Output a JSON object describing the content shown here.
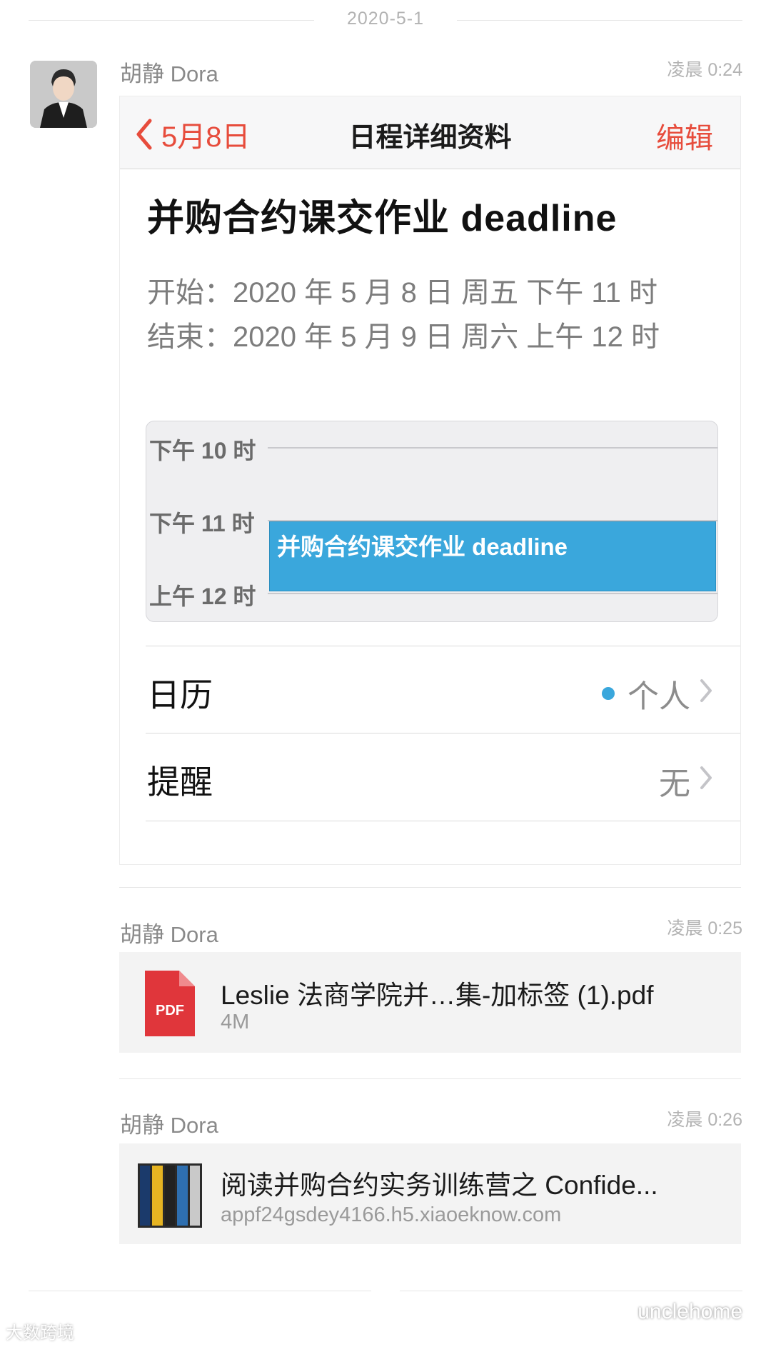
{
  "date_header": "2020-5-1",
  "messages": [
    {
      "sender": "胡静 Dora",
      "time": "凌晨 0:24"
    },
    {
      "sender": "胡静 Dora",
      "time": "凌晨 0:25"
    },
    {
      "sender": "胡静 Dora",
      "time": "凌晨 0:26"
    }
  ],
  "calendar": {
    "back_label": "5月8日",
    "nav_title": "日程详细资料",
    "edit_label": "编辑",
    "event_title": "并购合约课交作业 deadline",
    "start": "开始：2020 年 5 月 8 日 周五 下午 11 时",
    "end": "结束：2020 年 5 月 9 日 周六 上午 12 时",
    "timeline": {
      "labels": [
        "下午 10 时",
        "下午 11 时",
        "上午 12 时"
      ],
      "event_label": "并购合约课交作业 deadline"
    },
    "rows": [
      {
        "label": "日历",
        "value": "个人"
      },
      {
        "label": "提醒",
        "value": "无"
      }
    ],
    "accent_color": "#e74c3c",
    "event_color": "#3aa7dc"
  },
  "file_message": {
    "icon_label": "PDF",
    "name": "Leslie 法商学院并…集-加标签 (1).pdf",
    "size": "4M"
  },
  "link_message": {
    "title": "阅读并购合约实务训练营之 Confide...",
    "url": "appf24gsdey4166.h5.xiaoeknow.com"
  },
  "watermarks": {
    "left": "大数跨境",
    "right": "unclehome"
  }
}
